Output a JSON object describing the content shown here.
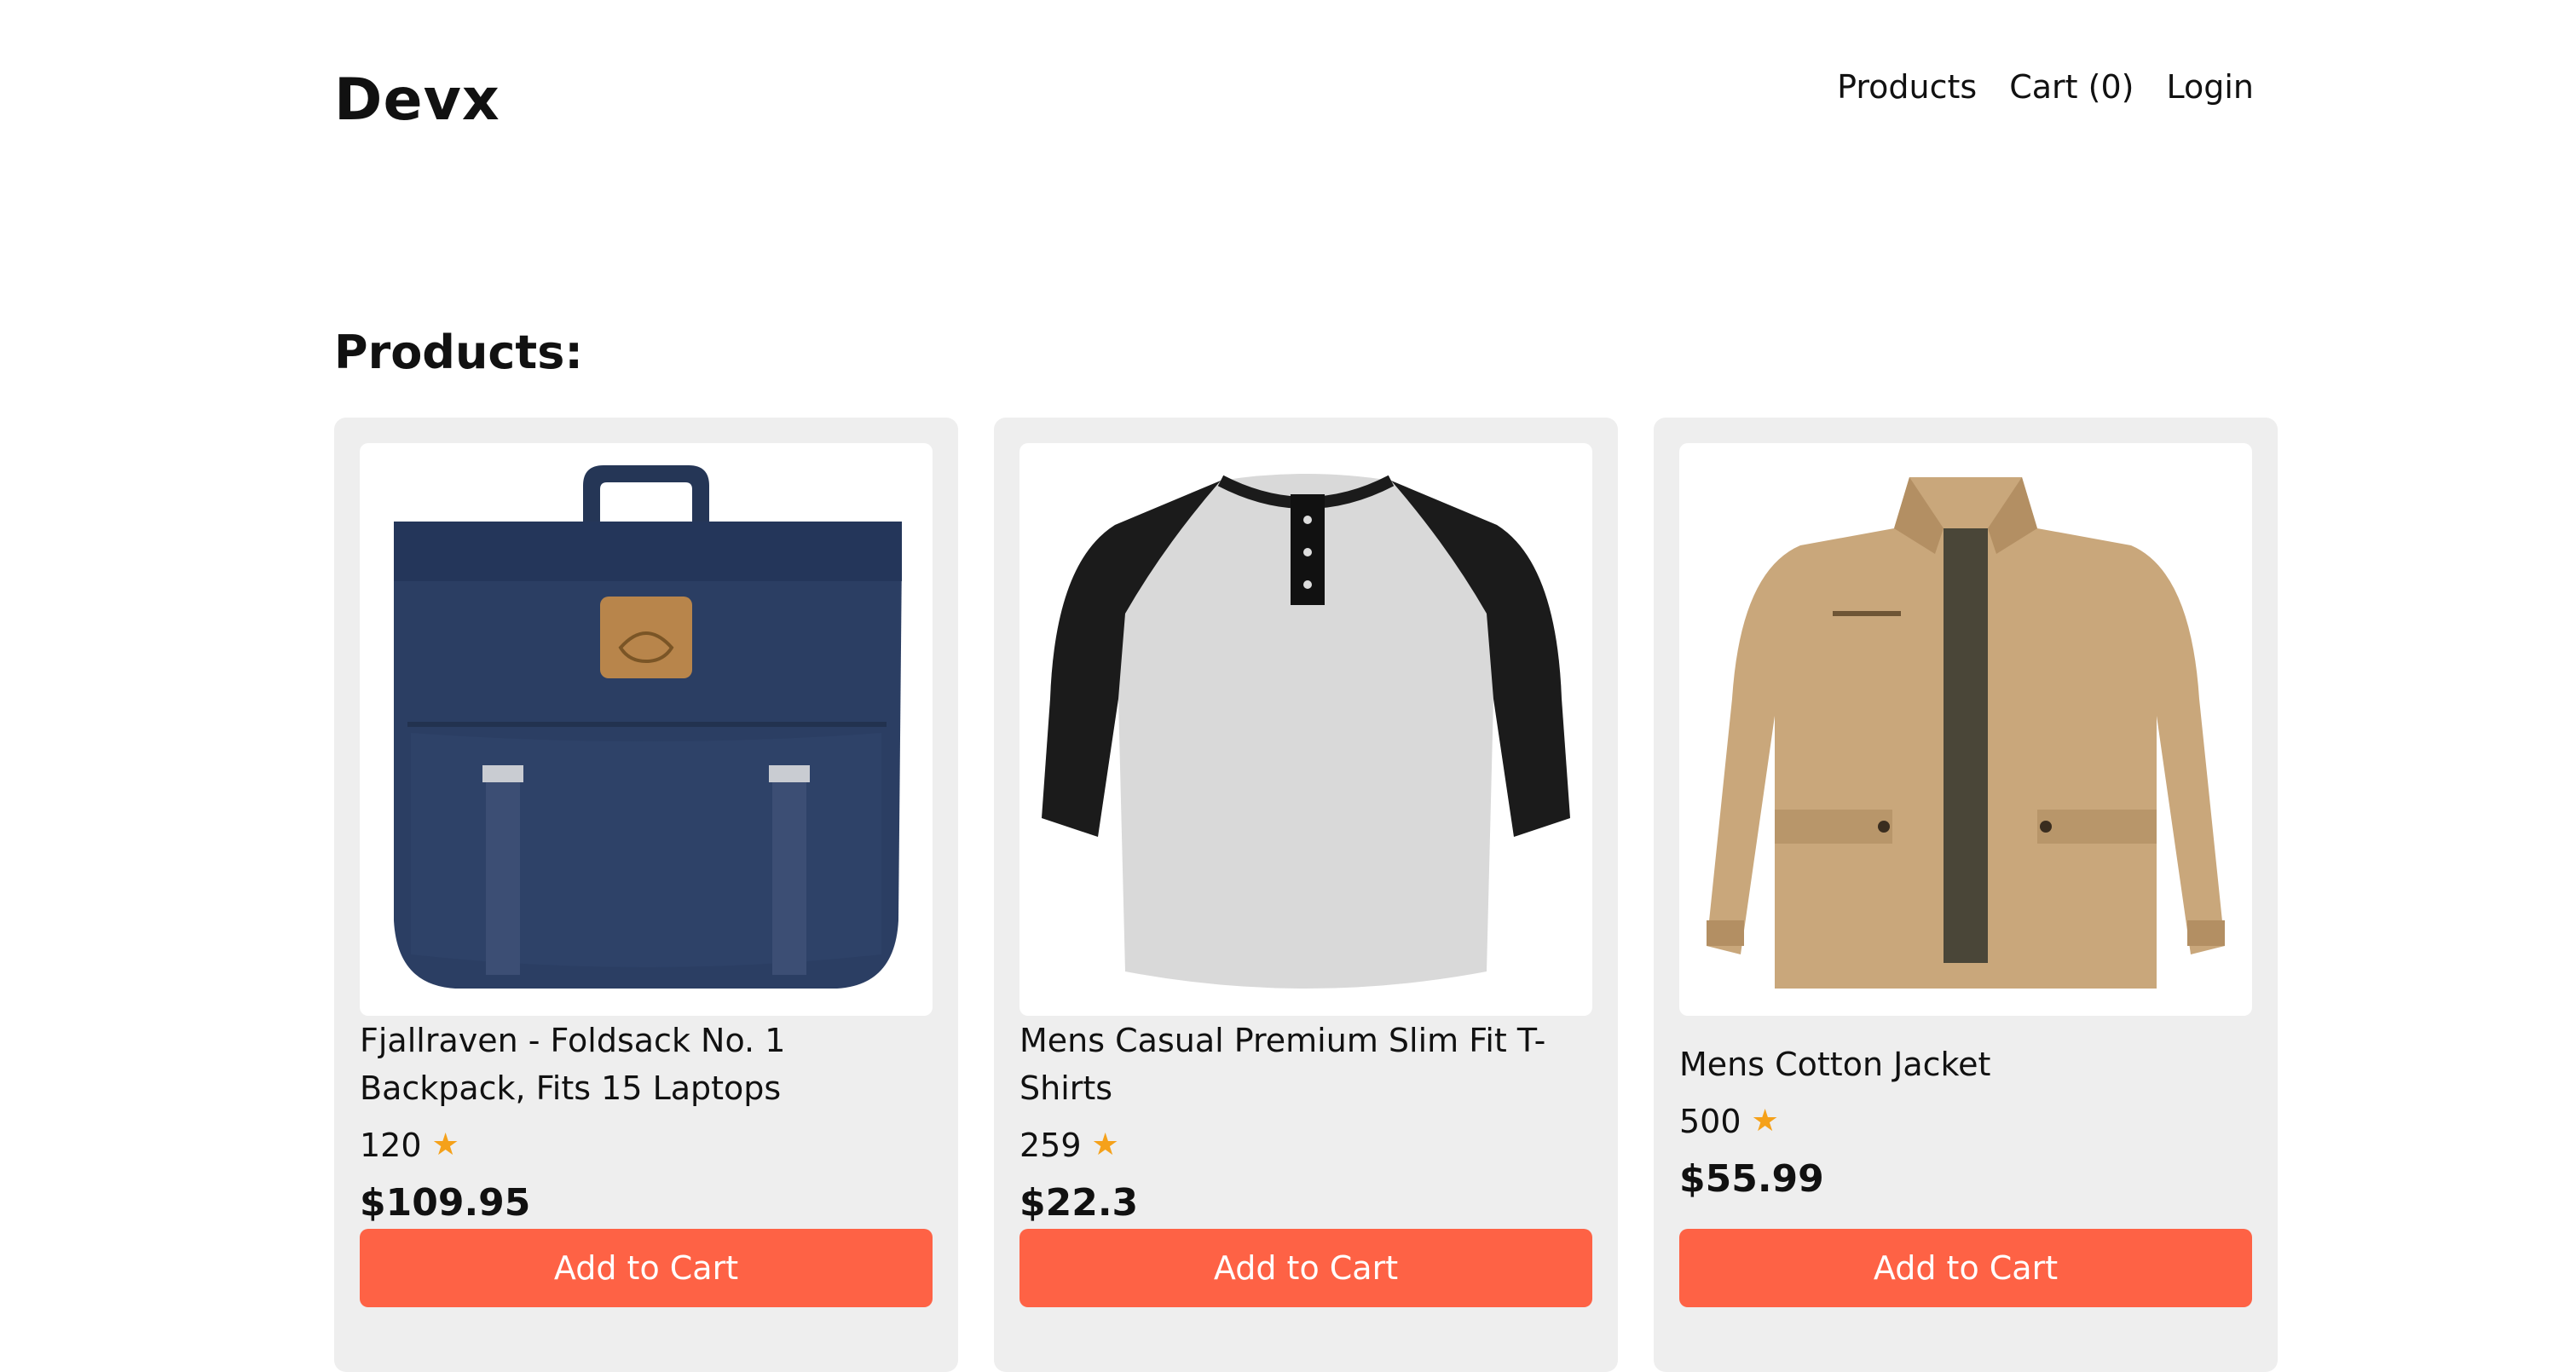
{
  "header": {
    "logo": "Devx",
    "nav": {
      "products": "Products",
      "cart": "Cart (0)",
      "login": "Login"
    }
  },
  "section_title": "Products:",
  "products": [
    {
      "title": "Fjallraven - Foldsack No. 1 Backpack, Fits 15 Laptops",
      "rating": "120",
      "price": "$109.95",
      "button": "Add to Cart",
      "image_icon": "backpack-image"
    },
    {
      "title": "Mens Casual Premium Slim Fit T-Shirts",
      "rating": "259",
      "price": "$22.3",
      "button": "Add to Cart",
      "image_icon": "tshirt-image"
    },
    {
      "title": "Mens Cotton Jacket",
      "rating": "500",
      "price": "$55.99",
      "button": "Add to Cart",
      "image_icon": "jacket-image"
    }
  ],
  "colors": {
    "accent": "#fe6245",
    "card_bg": "#eeeeee",
    "star": "#f5a11a"
  }
}
